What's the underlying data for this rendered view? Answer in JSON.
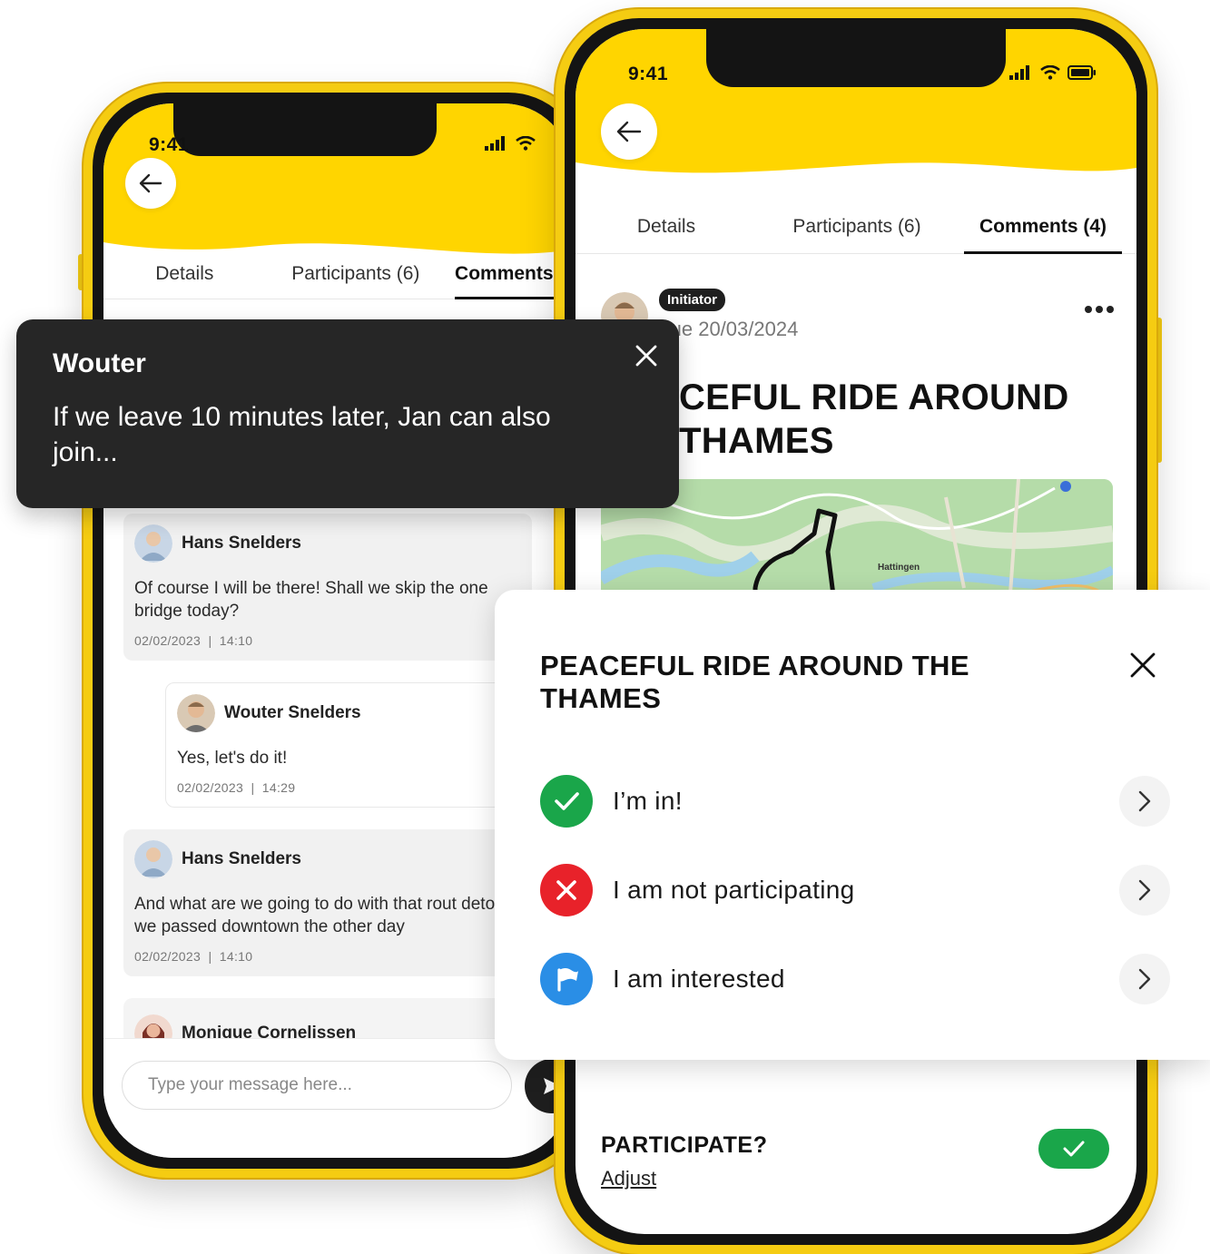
{
  "left_phone": {
    "time": "9:41",
    "tabs": [
      {
        "label": "Details"
      },
      {
        "label": "Participants (6)"
      },
      {
        "label": "Comments ("
      }
    ],
    "comments": [
      {
        "author": "Hans Snelders",
        "text": "Of course I will be there! Shall we skip the one bridge today?",
        "date": "02/02/2023",
        "time": "14:10"
      },
      {
        "author": "Wouter Snelders",
        "text": "Yes, let's do it!",
        "date": "02/02/2023",
        "time": "14:29"
      },
      {
        "author": "Hans Snelders",
        "text": "And what are we going to do with that rout detour we passed downtown the other day",
        "date": "02/02/2023",
        "time": "14:10"
      },
      {
        "author": "Monique Cornelissen"
      }
    ],
    "message_input": {
      "placeholder": "Type your message here..."
    }
  },
  "right_phone": {
    "time": "9:41",
    "tabs": [
      {
        "label": "Details"
      },
      {
        "label": "Participants (6)"
      },
      {
        "label": "Comments (4)"
      }
    ],
    "initiator_badge": "Initiator",
    "date": "Tue  20/03/2024",
    "title_line1": "CEFUL RIDE AROUND",
    "title_line2": "THAMES",
    "map_label": "Hattingen",
    "participate_label": "PARTICIPATE?",
    "adjust_link": "Adjust"
  },
  "notification": {
    "sender": "Wouter",
    "message": "If we leave 10 minutes later, Jan can also join..."
  },
  "participation_sheet": {
    "title": "PEACEFUL RIDE AROUND THE THAMES",
    "options": [
      {
        "label": "I’m in!",
        "icon": "check-icon",
        "color": "#1aa64a"
      },
      {
        "label": "I am not participating",
        "icon": "x-icon",
        "color": "#e8222a"
      },
      {
        "label": "I am interested",
        "icon": "flag-icon",
        "color": "#2a8ee6"
      }
    ]
  },
  "colors": {
    "brand_yellow": "#ffd500",
    "dark": "#262626"
  }
}
